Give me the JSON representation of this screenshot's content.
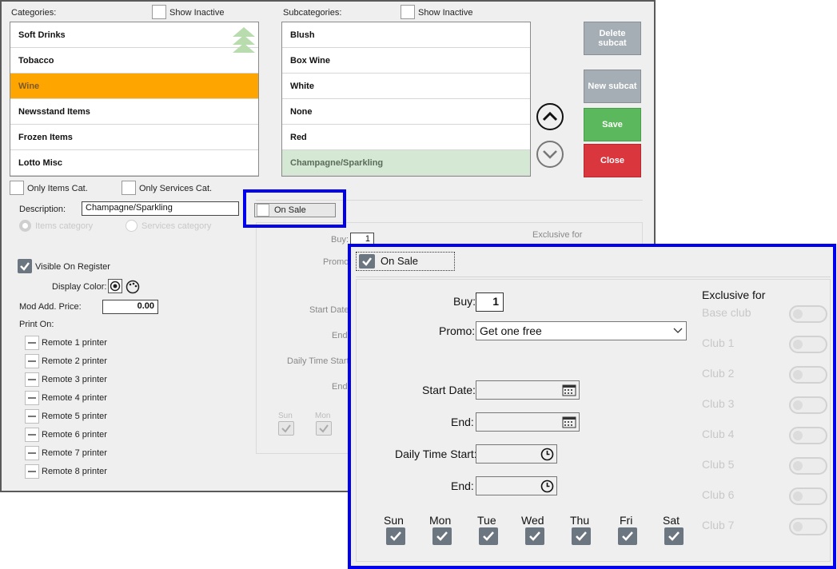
{
  "categories": {
    "label": "Categories:",
    "show_inactive_label": "Show Inactive",
    "items": [
      "Soft Drinks",
      "Tobacco",
      "Wine",
      "Newsstand Items",
      "Frozen Items",
      "Lotto Misc"
    ]
  },
  "subcategories": {
    "label": "Subcategories:",
    "show_inactive_label": "Show Inactive",
    "items": [
      "Blush",
      "Box Wine",
      "White",
      "None",
      "Red",
      "Champagne/Sparkling"
    ]
  },
  "buttons": {
    "delete_subcat": "Delete subcat",
    "new_subcat": "New subcat",
    "save": "Save",
    "close": "Close"
  },
  "filters": {
    "only_items_cat": "Only Items Cat.",
    "only_services_cat": "Only Services Cat."
  },
  "form": {
    "description_label": "Description:",
    "description_value": "Champagne/Sparkling",
    "items_category": "Items category",
    "services_category": "Services category",
    "visible_on_register": "Visible On Register",
    "display_color": "Display Color:",
    "mod_add_price": "Mod Add. Price:",
    "mod_add_price_value": "0.00",
    "print_on": "Print On:",
    "printers": [
      "Remote 1 printer",
      "Remote 2 printer",
      "Remote 3 printer",
      "Remote 4 printer",
      "Remote 5 printer",
      "Remote 6 printer",
      "Remote 7 printer",
      "Remote 8 printer"
    ]
  },
  "sale_small": {
    "on_sale": "On Sale",
    "buy": "Buy:",
    "buy_value": "1",
    "promo": "Promo",
    "exclusive_for": "Exclusive for",
    "start_date": "Start Date",
    "end": "End",
    "daily_time_start": "Daily Time Start",
    "end2": "End",
    "days": [
      "Sun",
      "Mon"
    ]
  },
  "sale_zoom": {
    "on_sale": "On Sale",
    "buy": "Buy:",
    "buy_value": "1",
    "promo": "Promo:",
    "promo_value": "Get one free",
    "start_date": "Start Date:",
    "end": "End:",
    "daily_time_start": "Daily Time Start:",
    "end2": "End:",
    "days": [
      "Sun",
      "Mon",
      "Tue",
      "Wed",
      "Thu",
      "Fri",
      "Sat"
    ],
    "exclusive_for": "Exclusive for",
    "clubs": [
      "Base club",
      "Club 1",
      "Club 2",
      "Club 3",
      "Club 4",
      "Club 5",
      "Club 6",
      "Club 7"
    ]
  },
  "colors": {
    "selected_category": "#ffa500",
    "selected_subcategory": "#d5e8d4",
    "save": "#5cb85c",
    "close": "#d9363e",
    "highlight_border": "#0000ee"
  }
}
